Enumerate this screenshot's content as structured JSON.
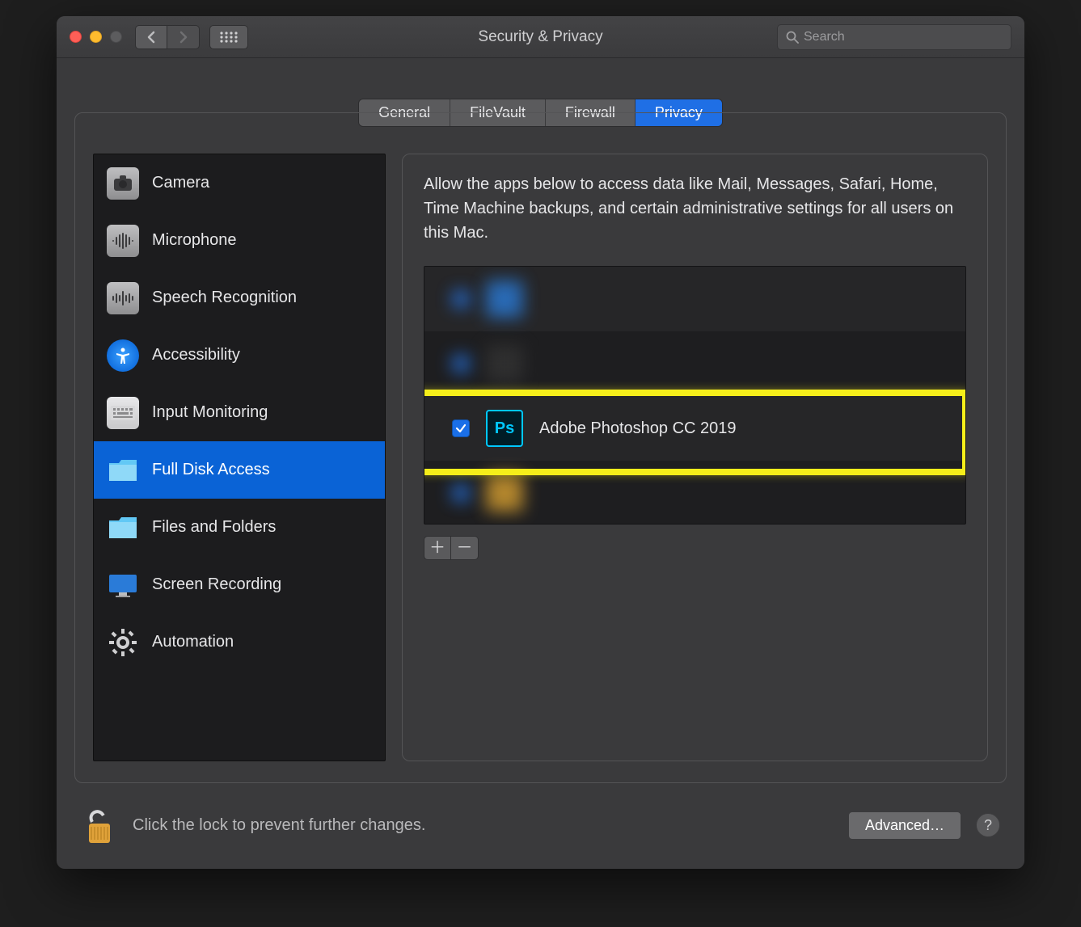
{
  "window": {
    "title": "Security & Privacy"
  },
  "search": {
    "placeholder": "Search"
  },
  "tabs": [
    {
      "label": "General",
      "active": false
    },
    {
      "label": "FileVault",
      "active": false
    },
    {
      "label": "Firewall",
      "active": false
    },
    {
      "label": "Privacy",
      "active": true
    }
  ],
  "categories": [
    {
      "label": "Camera",
      "icon": "camera",
      "selected": false
    },
    {
      "label": "Microphone",
      "icon": "microphone",
      "selected": false
    },
    {
      "label": "Speech Recognition",
      "icon": "waveform",
      "selected": false
    },
    {
      "label": "Accessibility",
      "icon": "accessibility",
      "selected": false
    },
    {
      "label": "Input Monitoring",
      "icon": "keyboard",
      "selected": false
    },
    {
      "label": "Full Disk Access",
      "icon": "folder",
      "selected": true
    },
    {
      "label": "Files and Folders",
      "icon": "folder",
      "selected": false
    },
    {
      "label": "Screen Recording",
      "icon": "display",
      "selected": false
    },
    {
      "label": "Automation",
      "icon": "gear",
      "selected": false
    }
  ],
  "detail": {
    "description": "Allow the apps below to access data like Mail, Messages, Safari, Home, Time Machine backups, and certain administrative settings for all users on this Mac."
  },
  "apps": [
    {
      "name": "",
      "checked": true,
      "blurred": true
    },
    {
      "name": "",
      "checked": true,
      "blurred": true
    },
    {
      "name": "Adobe Photoshop CC 2019",
      "checked": true,
      "blurred": false,
      "icon": "ps",
      "highlighted": true
    },
    {
      "name": "",
      "checked": true,
      "blurred": true
    }
  ],
  "footer": {
    "lock_text": "Click the lock to prevent further changes.",
    "advanced_label": "Advanced…"
  }
}
